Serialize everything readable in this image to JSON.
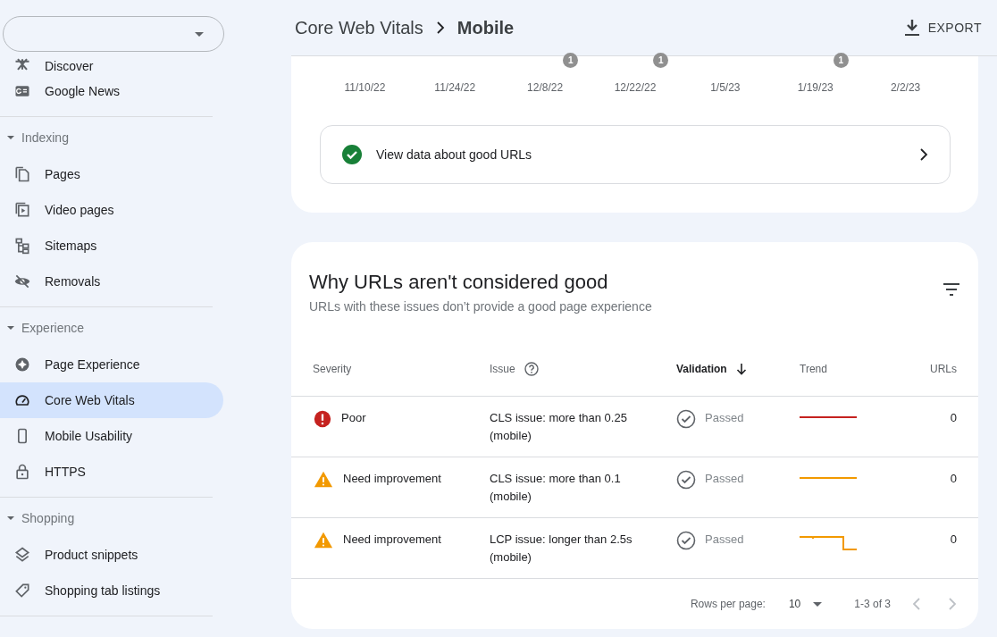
{
  "sidebar": {
    "top_items": [
      {
        "label": "Discover",
        "selected": false
      },
      {
        "label": "Google News",
        "selected": false
      }
    ],
    "sections": [
      {
        "title": "Indexing",
        "expanded": true,
        "items": [
          {
            "label": "Pages",
            "selected": false
          },
          {
            "label": "Video pages",
            "selected": false
          },
          {
            "label": "Sitemaps",
            "selected": false
          },
          {
            "label": "Removals",
            "selected": false
          }
        ]
      },
      {
        "title": "Experience",
        "expanded": true,
        "items": [
          {
            "label": "Page Experience",
            "selected": false
          },
          {
            "label": "Core Web Vitals",
            "selected": true
          },
          {
            "label": "Mobile Usability",
            "selected": false
          },
          {
            "label": "HTTPS",
            "selected": false
          }
        ]
      },
      {
        "title": "Shopping",
        "expanded": true,
        "items": [
          {
            "label": "Product snippets",
            "selected": false
          },
          {
            "label": "Shopping tab listings",
            "selected": false
          }
        ]
      }
    ]
  },
  "header": {
    "breadcrumb": [
      "Core Web Vitals",
      "Mobile"
    ],
    "export": "EXPORT"
  },
  "timeline": {
    "dates": [
      {
        "label": "11/10/22"
      },
      {
        "label": "11/24/22"
      },
      {
        "label": "12/8/22",
        "annotation": "1"
      },
      {
        "label": "12/22/22",
        "annotation": "1"
      },
      {
        "label": "1/5/23"
      },
      {
        "label": "1/19/23",
        "annotation": "1"
      },
      {
        "label": "2/2/23"
      }
    ]
  },
  "good_urls_link": {
    "label": "View data about good URLs"
  },
  "issues": {
    "title": "Why URLs aren't considered good",
    "subtitle": "URLs with these issues don’t provide a good page experience",
    "columns": [
      {
        "label": "Severity",
        "sorted": false,
        "help": false
      },
      {
        "label": "Issue",
        "sorted": false,
        "help": true
      },
      {
        "label": "Validation",
        "sorted": true,
        "help": false
      },
      {
        "label": "Trend",
        "sorted": false,
        "help": false
      },
      {
        "label": "URLs",
        "sorted": false,
        "help": false
      }
    ],
    "rows": [
      {
        "severity": "Poor",
        "kind": "poor",
        "issue": "CLS issue: more than 0.25 (mobile)",
        "validation": "Passed",
        "urls": "0"
      },
      {
        "severity": "Need improvement",
        "kind": "warning",
        "issue": "CLS issue: more than 0.1 (mobile)",
        "validation": "Passed",
        "urls": "0"
      },
      {
        "severity": "Need improvement",
        "kind": "warning",
        "issue": "LCP issue: longer than 2.5s (mobile)",
        "validation": "Passed",
        "urls": "0"
      }
    ],
    "pagination": {
      "rows_per_page_label": "Rows per page:",
      "rows_per_page": "10",
      "range": "1-3 of 3"
    }
  }
}
